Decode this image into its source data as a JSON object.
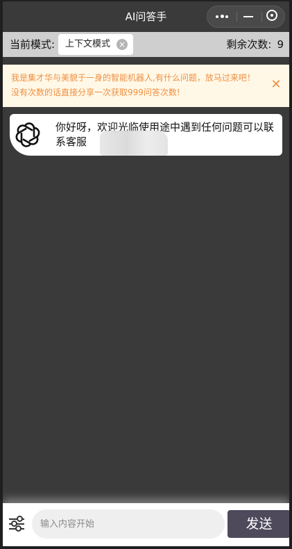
{
  "navbar": {
    "title": "AI问答手",
    "menu_icon": "more-dots-icon",
    "minimize_icon": "minus-icon",
    "close_icon": "target-circle-icon"
  },
  "mode_bar": {
    "label": "当前模式:",
    "mode_value": "上下文模式",
    "clear_icon": "close-circle-icon",
    "remaining_label": "剩余次数:",
    "remaining_count": "9"
  },
  "notice": {
    "text": "我是集才华与美貌于一身的智能机器人,有什么问题，放马过来吧！没有次数的话直接分享一次获取999问答次数!",
    "close_icon": "close-icon"
  },
  "chat": {
    "messages": [
      {
        "role": "assistant",
        "avatar": "openai-logo",
        "text": "你好呀，欢迎光临使用途中遇到任何问题可以联系客服"
      }
    ]
  },
  "input_bar": {
    "settings_icon": "sliders-icon",
    "placeholder": "输入内容开始",
    "send_label": "发送"
  },
  "colors": {
    "background": "#3a3a3a",
    "mode_bar": "#cfcfcf",
    "notice_bg": "#fff8e6",
    "notice_text": "#ef8f44",
    "send_button": "#4e4a5c"
  }
}
